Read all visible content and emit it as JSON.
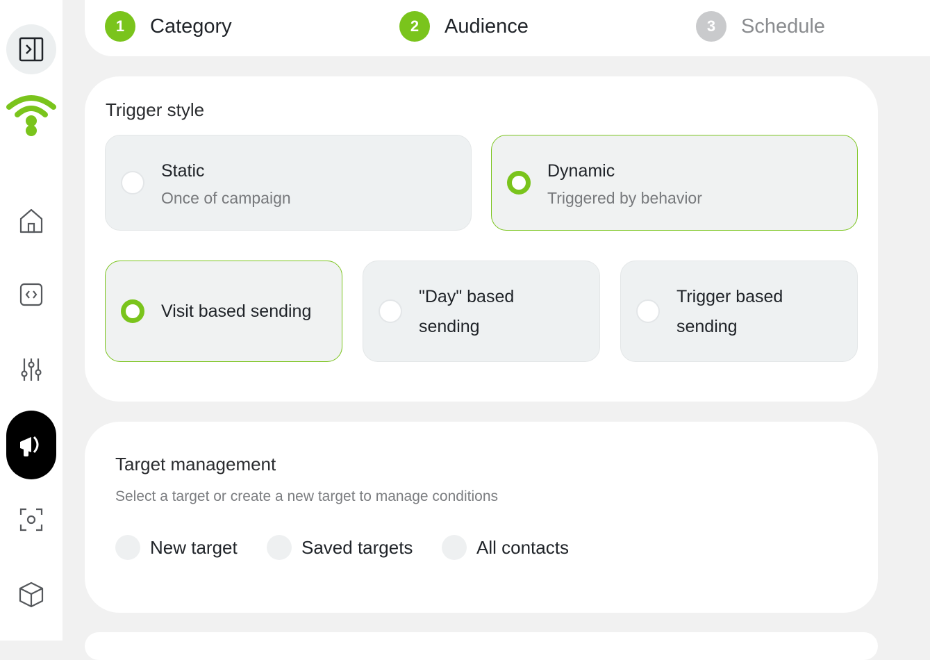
{
  "colors": {
    "accent": "#7ac41c",
    "inactive": "#c9cacc",
    "campaign_bg": "#000000"
  },
  "sidebar": {
    "items": [
      {
        "icon": "panel-toggle-icon"
      },
      {
        "icon": "wifi-logo-icon"
      },
      {
        "icon": "home-icon"
      },
      {
        "icon": "code-icon"
      },
      {
        "icon": "sliders-icon"
      },
      {
        "icon": "megaphone-icon",
        "active": true
      },
      {
        "icon": "scan-icon"
      },
      {
        "icon": "cube-icon"
      }
    ]
  },
  "stepper": {
    "steps": [
      {
        "num": "1",
        "label": "Category",
        "done": true
      },
      {
        "num": "2",
        "label": "Audience",
        "done": true
      },
      {
        "num": "3",
        "label": "Schedule",
        "done": false
      }
    ]
  },
  "trigger": {
    "title": "Trigger style",
    "static": {
      "title": "Static",
      "sub": "Once of campaign",
      "selected": false
    },
    "dynamic": {
      "title": "Dynamic",
      "sub": "Triggered by behavior",
      "selected": true
    },
    "modes": [
      {
        "label": "Visit based sending",
        "selected": true
      },
      {
        "label_1": "\"Day\" based",
        "label_2": "sending",
        "selected": false
      },
      {
        "label_1": "Trigger based",
        "label_2": "sending",
        "selected": false
      }
    ]
  },
  "target": {
    "title": "Target management",
    "subtitle": "Select a target or create a new target to manage conditions",
    "options": [
      {
        "label": "New target"
      },
      {
        "label": "Saved targets"
      },
      {
        "label": "All contacts"
      }
    ]
  }
}
